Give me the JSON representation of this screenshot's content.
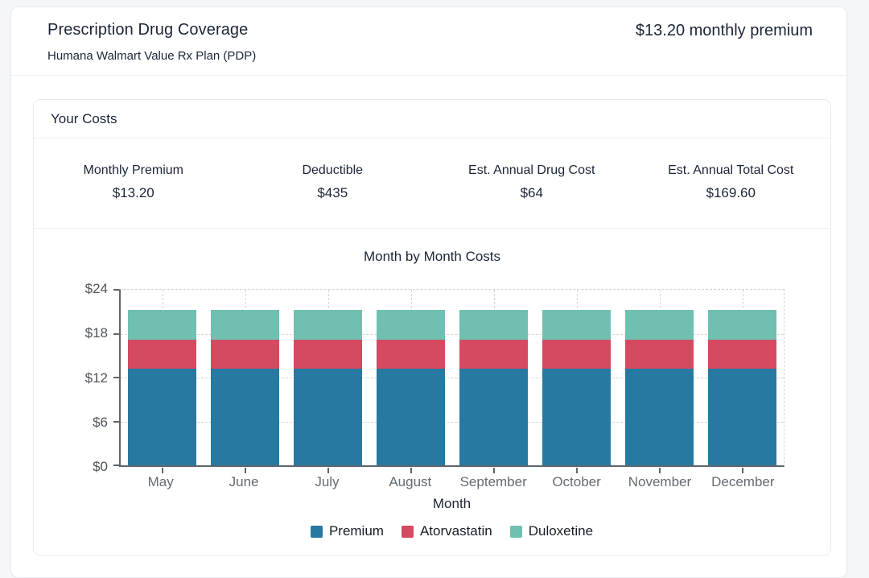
{
  "header": {
    "title": "Prescription Drug Coverage",
    "plan_name": "Humana Walmart Value Rx Plan (PDP)",
    "premium_summary": "$13.20 monthly premium"
  },
  "costs": {
    "section_title": "Your Costs",
    "stats": [
      {
        "label": "Monthly Premium",
        "value": "$13.20"
      },
      {
        "label": "Deductible",
        "value": "$435"
      },
      {
        "label": "Est. Annual Drug Cost",
        "value": "$64"
      },
      {
        "label": "Est. Annual Total Cost",
        "value": "$169.60"
      }
    ]
  },
  "chart_data": {
    "type": "bar",
    "stacked": true,
    "title": "Month by Month Costs",
    "xlabel": "Month",
    "ylabel": "",
    "categories": [
      "May",
      "June",
      "July",
      "August",
      "September",
      "October",
      "November",
      "December"
    ],
    "series": [
      {
        "name": "Premium",
        "color": "#2779a1",
        "values": [
          13.2,
          13.2,
          13.2,
          13.2,
          13.2,
          13.2,
          13.2,
          13.2
        ]
      },
      {
        "name": "Atorvastatin",
        "color": "#d54a61",
        "values": [
          4,
          4,
          4,
          4,
          4,
          4,
          4,
          4
        ]
      },
      {
        "name": "Duloxetine",
        "color": "#6fc0b0",
        "values": [
          4,
          4,
          4,
          4,
          4,
          4,
          4,
          4
        ]
      }
    ],
    "ylim": [
      0,
      24
    ],
    "yticks": [
      "$0",
      "$6",
      "$12",
      "$18",
      "$24"
    ],
    "ytick_values": [
      0,
      6,
      12,
      18,
      24
    ],
    "grid": "dashed",
    "legend_position": "bottom"
  }
}
